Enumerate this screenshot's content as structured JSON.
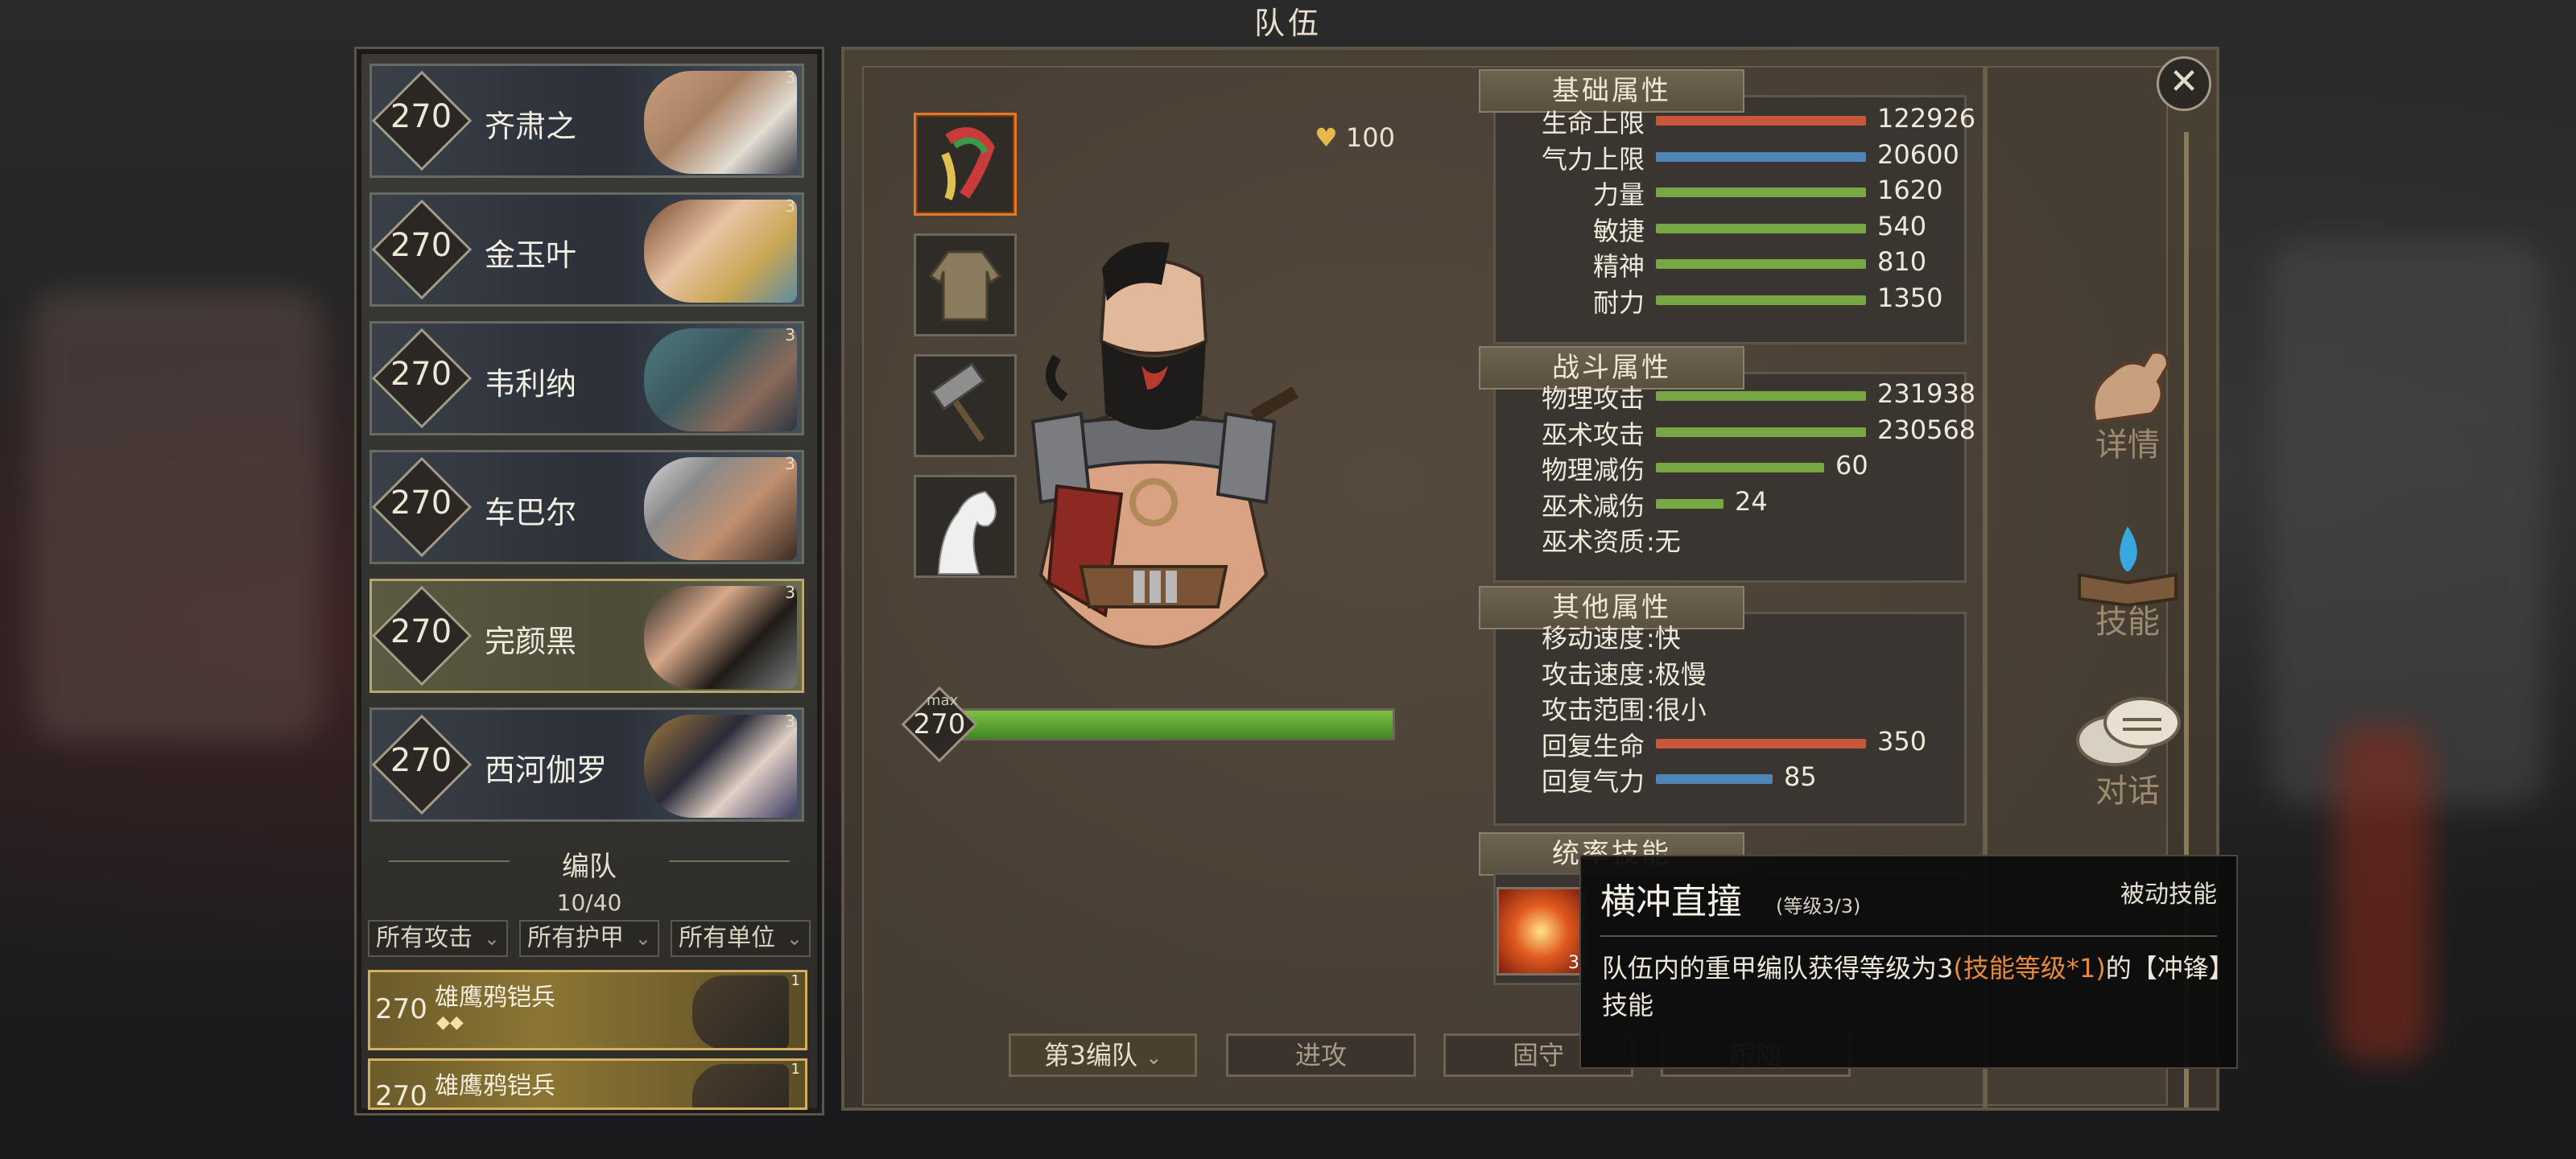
{
  "title": "队伍",
  "heroes": [
    {
      "level": "270",
      "name": "齐肃之",
      "stars": "3"
    },
    {
      "level": "270",
      "name": "金玉叶",
      "stars": "3"
    },
    {
      "level": "270",
      "name": "韦利纳",
      "stars": "3"
    },
    {
      "level": "270",
      "name": "车巴尔",
      "stars": "3"
    },
    {
      "level": "270",
      "name": "完颜黑",
      "stars": "3"
    },
    {
      "level": "270",
      "name": "西河伽罗",
      "stars": "3"
    }
  ],
  "formation": {
    "title": "编队",
    "count": "10/40",
    "filters": [
      "所有攻击",
      "所有护甲",
      "所有单位"
    ],
    "units": [
      {
        "level": "270",
        "name": "雄鹰鸦铠兵",
        "stars": "1",
        "gems": "◆◆"
      },
      {
        "level": "270",
        "name": "雄鹰鸦铠兵",
        "stars": "1",
        "gems": ""
      }
    ]
  },
  "character": {
    "gold": "100",
    "level": "270",
    "max_label": "max",
    "level_progress": 1.0
  },
  "stats": {
    "basic": {
      "title": "基础属性",
      "rows": [
        {
          "label": "生命上限",
          "value": "122926",
          "fill": 0.9,
          "color": "#c9573a"
        },
        {
          "label": "气力上限",
          "value": "20600",
          "fill": 0.9,
          "color": "#4e86b8"
        },
        {
          "label": "力量",
          "value": "1620",
          "fill": 0.9,
          "color": "#78a843"
        },
        {
          "label": "敏捷",
          "value": "540",
          "fill": 0.9,
          "color": "#78a843"
        },
        {
          "label": "精神",
          "value": "810",
          "fill": 0.9,
          "color": "#78a843"
        },
        {
          "label": "耐力",
          "value": "1350",
          "fill": 0.9,
          "color": "#78a843"
        }
      ]
    },
    "combat": {
      "title": "战斗属性",
      "rows": [
        {
          "label": "物理攻击",
          "value": "231938",
          "fill": 0.9,
          "color": "#78a843"
        },
        {
          "label": "巫术攻击",
          "value": "230568",
          "fill": 0.9,
          "color": "#78a843"
        },
        {
          "label": "物理减伤",
          "value": "60",
          "fill": 0.72,
          "color": "#78a843"
        },
        {
          "label": "巫术减伤",
          "value": "24",
          "fill": 0.29,
          "color": "#78a843"
        },
        {
          "label": "巫术资质",
          "value": ":无"
        }
      ]
    },
    "other": {
      "title": "其他属性",
      "rows": [
        {
          "label": "移动速度",
          "value": ":快"
        },
        {
          "label": "攻击速度",
          "value": ":极慢"
        },
        {
          "label": "攻击范围",
          "value": ":很小"
        },
        {
          "label": "回复生命",
          "value": "350",
          "fill": 0.9,
          "color": "#c9573a"
        },
        {
          "label": "回复气力",
          "value": "85",
          "fill": 0.5,
          "color": "#4e86b8"
        }
      ]
    },
    "command": {
      "title": "统率技能"
    }
  },
  "side_buttons": [
    "详情",
    "技能",
    "对话"
  ],
  "bottom_buttons": {
    "formation_select": "第3编队",
    "advance": "进攻",
    "hold": "固守",
    "hidden": "跟随"
  },
  "skill_icon_level": "3",
  "tooltip": {
    "name": "横冲直撞",
    "level": "(等级3/3)",
    "type": "被动技能",
    "desc_a": "队伍内的重甲编队获得等级为3",
    "desc_hl": "(技能等级*1)",
    "desc_b": "的【冲锋】技能"
  }
}
